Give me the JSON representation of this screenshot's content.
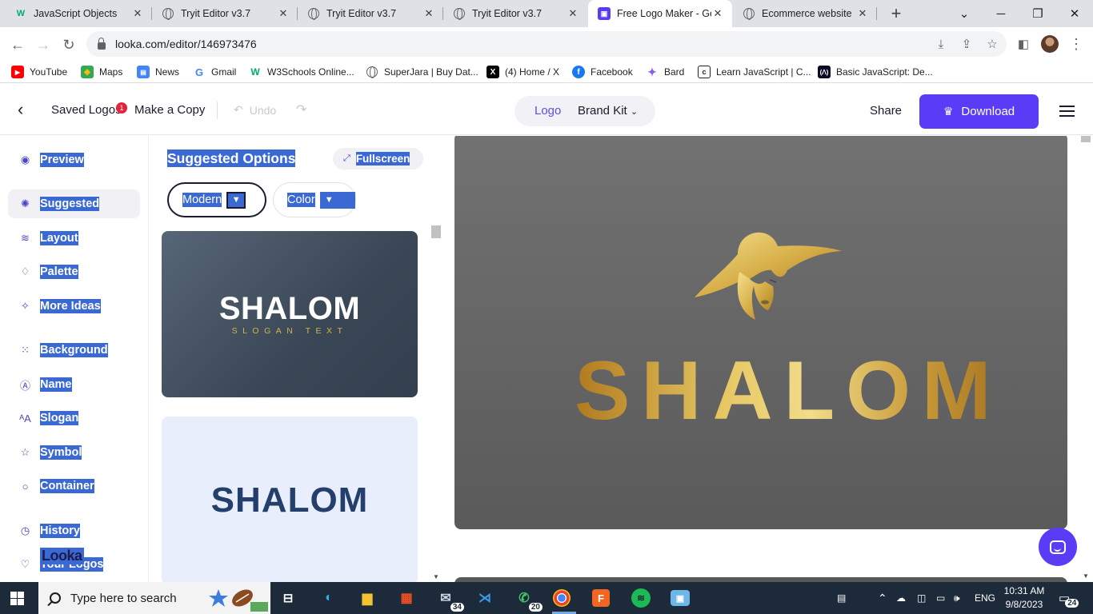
{
  "browser": {
    "tabs": [
      {
        "title": "JavaScript Objects",
        "icon": "w3schools-icon",
        "active": false
      },
      {
        "title": "Tryit Editor v3.7",
        "icon": "globe-icon",
        "active": false
      },
      {
        "title": "Tryit Editor v3.7",
        "icon": "globe-icon",
        "active": false
      },
      {
        "title": "Tryit Editor v3.7",
        "icon": "globe-icon",
        "active": false
      },
      {
        "title": "Free Logo Maker - Get",
        "icon": "looka-icon",
        "active": true
      },
      {
        "title": "Ecommerce website",
        "icon": "globe-icon",
        "active": false
      }
    ],
    "url": "looka.com/editor/146973476",
    "bookmarks": [
      {
        "label": "YouTube",
        "icon": "youtube-icon"
      },
      {
        "label": "Maps",
        "icon": "maps-icon"
      },
      {
        "label": "News",
        "icon": "news-icon"
      },
      {
        "label": "Gmail",
        "icon": "google-icon"
      },
      {
        "label": "W3Schools Online...",
        "icon": "w3schools-icon"
      },
      {
        "label": "SuperJara | Buy Dat...",
        "icon": "globe-icon"
      },
      {
        "label": "(4) Home / X",
        "icon": "x-icon"
      },
      {
        "label": "Facebook",
        "icon": "facebook-icon"
      },
      {
        "label": "Bard",
        "icon": "bard-icon"
      },
      {
        "label": "Learn JavaScript | C...",
        "icon": "codecademy-icon"
      },
      {
        "label": "Basic JavaScript: De...",
        "icon": "freecodecamp-icon"
      }
    ]
  },
  "header": {
    "saved_logos": "Saved Logos",
    "saved_badge": "1",
    "make_copy": "Make a Copy",
    "undo": "Undo",
    "seg_logo": "Logo",
    "seg_brand": "Brand Kit",
    "share": "Share",
    "download": "Download"
  },
  "sidebar": {
    "items": [
      {
        "label": "Preview",
        "icon": "eye-icon"
      },
      {
        "label": "Suggested",
        "icon": "lightbulb-icon",
        "active": true
      },
      {
        "label": "Layout",
        "icon": "layers-icon"
      },
      {
        "label": "Palette",
        "icon": "droplet-icon"
      },
      {
        "label": "More Ideas",
        "icon": "magic-wand-icon"
      },
      {
        "label": "Background",
        "icon": "grid-dots-icon"
      },
      {
        "label": "Name",
        "icon": "text-box-icon"
      },
      {
        "label": "Slogan",
        "icon": "font-size-icon"
      },
      {
        "label": "Symbol",
        "icon": "star-icon"
      },
      {
        "label": "Container",
        "icon": "circle-icon"
      },
      {
        "label": "History",
        "icon": "history-icon"
      },
      {
        "label": "Your Logos",
        "icon": "heart-icon"
      }
    ],
    "overlay_logo": "Looka"
  },
  "panel": {
    "title": "Suggested Options",
    "fullscreen": "Fullscreen",
    "filter_style": "Modern",
    "filter_color": "Color",
    "cards": [
      {
        "name": "SHALOM",
        "slogan": "SLOGAN TEXT"
      },
      {
        "name": "SHALOM"
      }
    ]
  },
  "canvas": {
    "logo_name": "SHALOM"
  },
  "taskbar": {
    "search_placeholder": "Type here to search",
    "mail_count": "34",
    "whatsapp_count": "20",
    "language": "ENG",
    "time": "10:31 AM",
    "date": "9/8/2023",
    "notification_count": "24"
  },
  "colors": {
    "accent": "#5b3cf6",
    "selection": "#3b69d4",
    "gold": "#e6c763",
    "canvas_bg": "#666666"
  }
}
